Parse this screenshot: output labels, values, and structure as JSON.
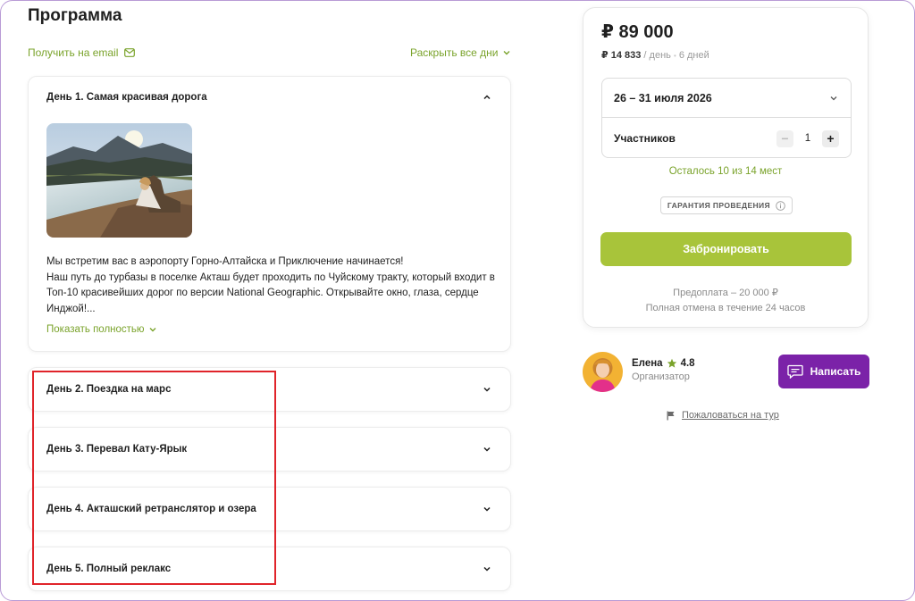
{
  "program": {
    "title": "Программа",
    "email_label": "Получить на email",
    "expand_label": "Раскрыть все дни"
  },
  "days": [
    {
      "title": "День 1. Самая красивая дорога",
      "expanded": true,
      "text": "Мы встретим вас в аэропорту Горно-Алтайска и Приключение начинается!\nНаш путь до турбазы в поселке Акташ будет проходить по Чуйскому тракту, который входит в Топ-10 красивейших дорог по версии National Geographic. Открывайте окно, глаза, сердце Инджой!...",
      "show_more": "Показать полностью"
    },
    {
      "title": "День 2. Поездка на марс",
      "expanded": false
    },
    {
      "title": "День 3. Перевал Кату-Ярык",
      "expanded": false
    },
    {
      "title": "День 4. Акташский ретранслятор и озера",
      "expanded": false
    },
    {
      "title": "День 5. Полный реклакс",
      "expanded": false
    }
  ],
  "booking": {
    "price": "₽ 89 000",
    "per_day": "₽ 14 833",
    "per_day_suffix": "/ день",
    "dot": "•",
    "duration": "6 дней",
    "dates": "26 – 31 июля 2026",
    "participants_label": "Участников",
    "participants_count": "1",
    "minus": "−",
    "plus": "+",
    "seats_left": "Осталось 10 из 14 мест",
    "guarantee": "ГАРАНТИЯ ПРОВЕДЕНИЯ",
    "book_label": "Забронировать",
    "prepay": "Предоплата – 20 000 ₽",
    "cancel": "Полная отмена в течение 24 часов"
  },
  "organizer": {
    "name": "Елена",
    "rating": "4.8",
    "role": "Организатор",
    "write_label": "Написать",
    "report_label": "Пожаловаться на тур"
  },
  "colors": {
    "accent_green": "#7aa32b",
    "button_green": "#a8c43a",
    "purple": "#7b22a8",
    "highlight_red": "#e0242a"
  }
}
